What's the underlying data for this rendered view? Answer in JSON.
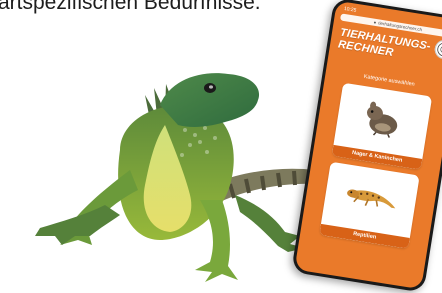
{
  "heading": {
    "text": "artspezifischen Bedürfnisse."
  },
  "phone": {
    "status_time": "10:25",
    "url": "tierhaltungsrechner.ch",
    "title_line1": "TIERHALTUNGS-",
    "title_line2": "RECHNER",
    "subtitle": "Kategorie auswählen",
    "categories": [
      {
        "label": "Nager & Kaninchen",
        "icon": "rodent-icon"
      },
      {
        "label": "Reptilien",
        "icon": "gecko-icon"
      }
    ]
  },
  "colors": {
    "brand_orange": "#ea7a2a",
    "label_orange": "#d86217"
  }
}
